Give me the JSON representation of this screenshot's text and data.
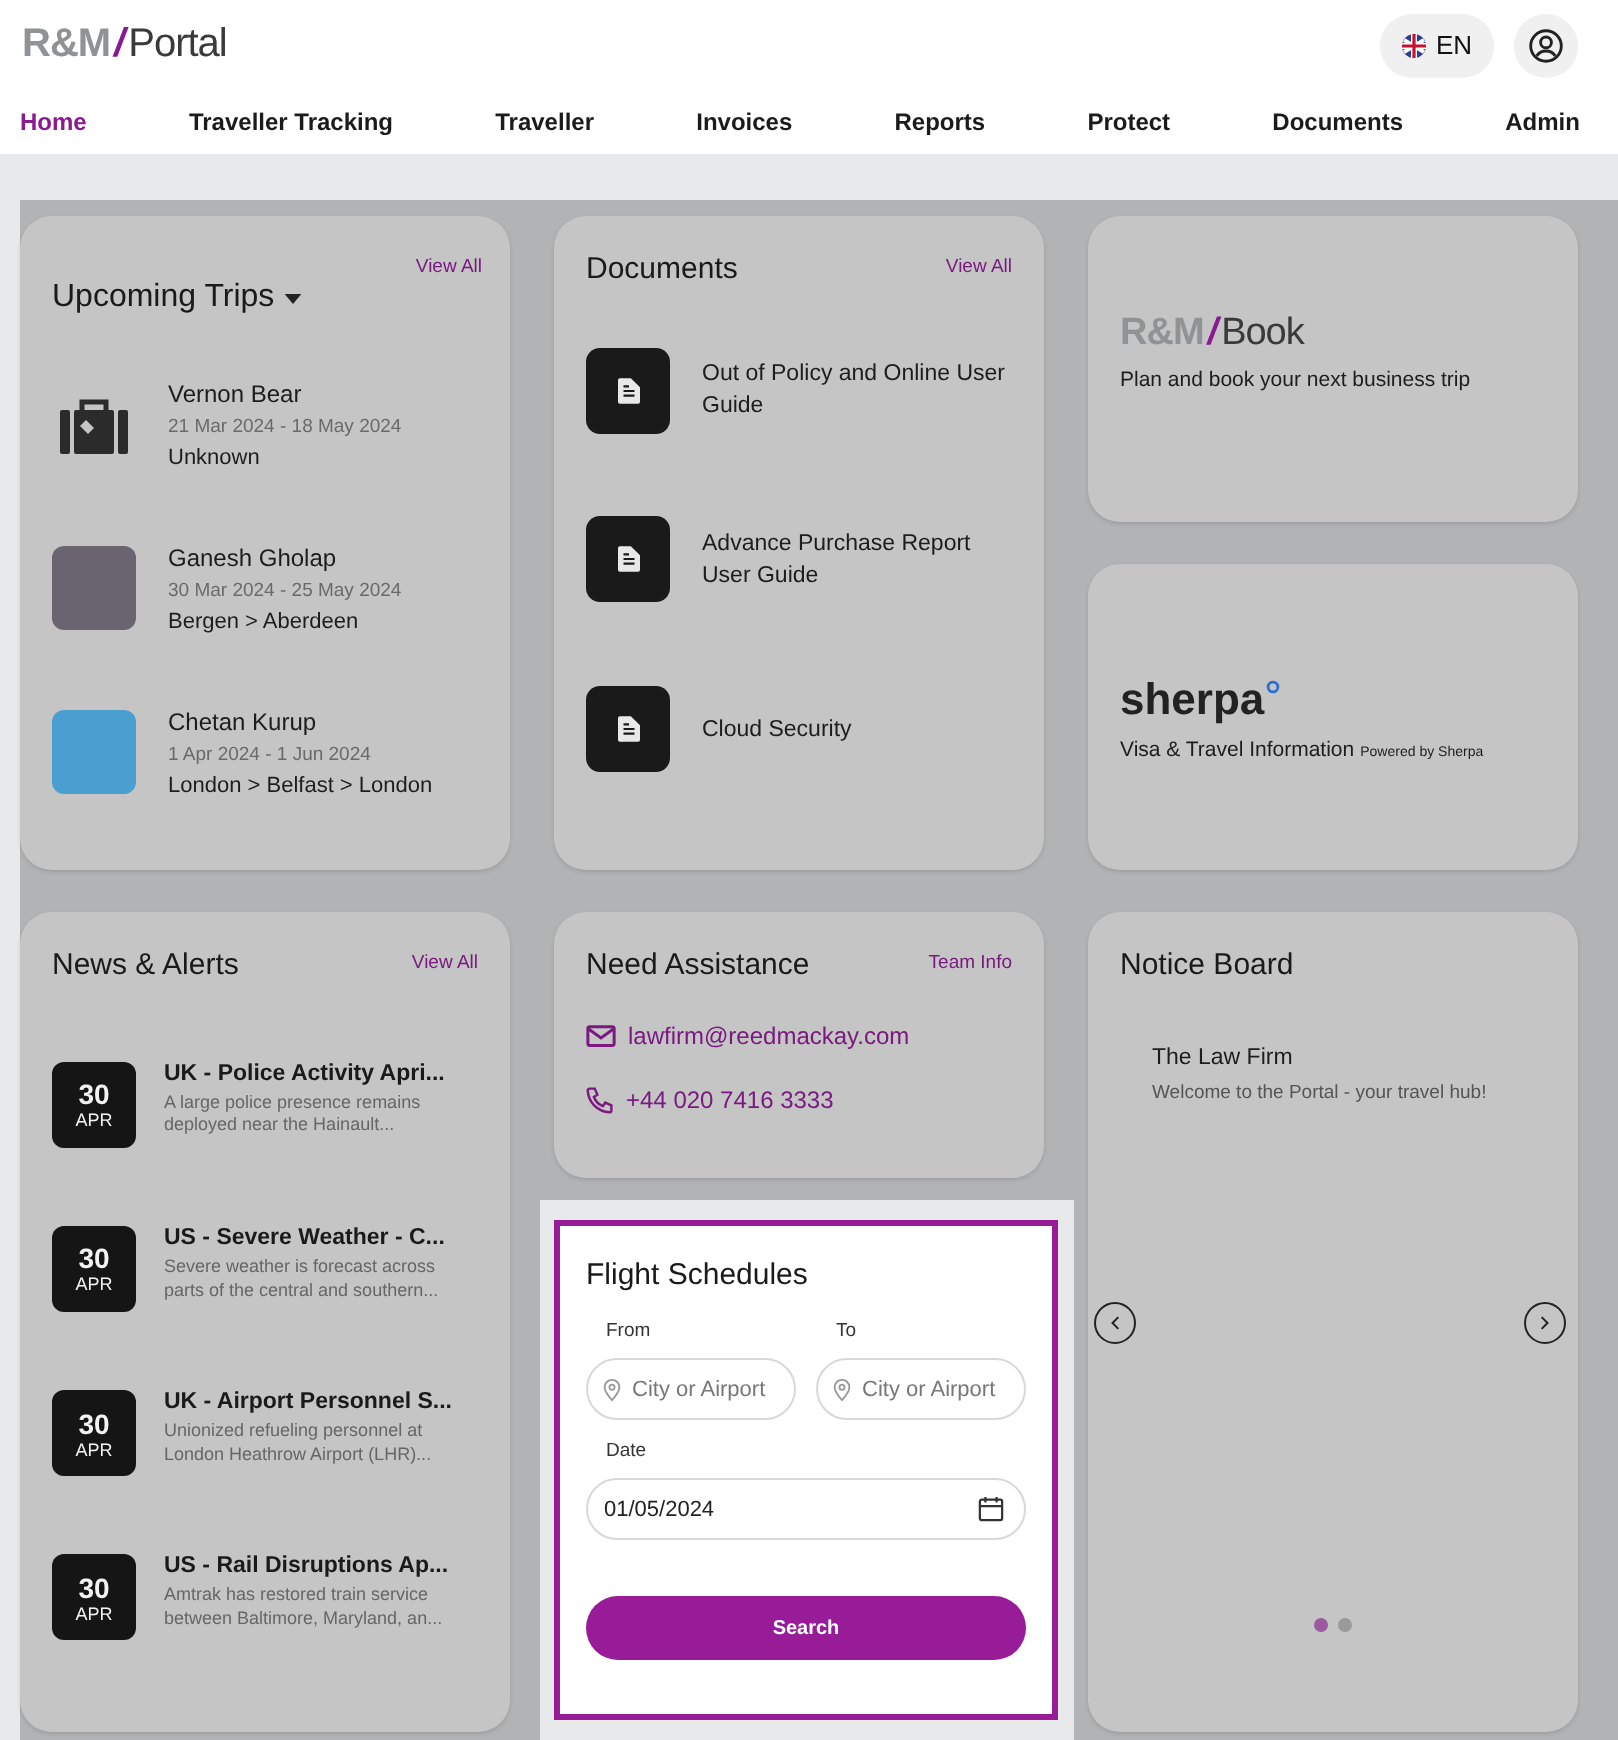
{
  "header": {
    "logo": {
      "mark": "R&M",
      "slash": "/",
      "product": "Portal"
    },
    "language": "EN"
  },
  "nav": [
    {
      "label": "Home",
      "selected": true
    },
    {
      "label": "Traveller Tracking",
      "selected": false
    },
    {
      "label": "Traveller",
      "selected": false
    },
    {
      "label": "Invoices",
      "selected": false
    },
    {
      "label": "Reports",
      "selected": false
    },
    {
      "label": "Protect",
      "selected": false
    },
    {
      "label": "Documents",
      "selected": false
    },
    {
      "label": "Admin",
      "selected": false
    }
  ],
  "upcoming_trips": {
    "title": "Upcoming Trips",
    "link": "View All",
    "items": [
      {
        "kind": "icon",
        "name": "Vernon Bear",
        "dates": "21 Mar 2024 - 18 May 2024",
        "route": "Unknown"
      },
      {
        "kind": "photo",
        "name": "Ganesh Gholap",
        "dates": "30 Mar 2024 - 25 May 2024",
        "route": "Bergen > Aberdeen"
      },
      {
        "kind": "photo",
        "name": "Chetan Kurup",
        "dates": "1 Apr 2024 - 1 Jun 2024",
        "route": "London > Belfast > London"
      }
    ]
  },
  "documents": {
    "title": "Documents",
    "link": "View All",
    "items": [
      "Out of Policy and Online User Guide",
      "Advance Purchase Report User Guide",
      "Cloud Security"
    ]
  },
  "book": {
    "logo": {
      "mark": "R&M",
      "slash": "/",
      "product": "Book"
    },
    "tagline": "Plan and book your next business trip"
  },
  "sherpa": {
    "logo": "sherpa",
    "tagline": "Visa & Travel Information",
    "powered": "Powered by Sherpa"
  },
  "news": {
    "title": "News & Alerts",
    "link": "View All",
    "items": [
      {
        "day": "30",
        "month": "APR",
        "title": "UK - Police Activity Apri...",
        "summary": "A large police presence remains deployed near the Hainault..."
      },
      {
        "day": "30",
        "month": "APR",
        "title": "US - Severe Weather - C...",
        "summary": "Severe weather is forecast across parts of the central and southern..."
      },
      {
        "day": "30",
        "month": "APR",
        "title": "UK - Airport Personnel S...",
        "summary": "Unionized refueling personnel at London Heathrow Airport (LHR)..."
      },
      {
        "day": "30",
        "month": "APR",
        "title": "US - Rail Disruptions Ap...",
        "summary": "Amtrak has restored train service between Baltimore, Maryland, an..."
      }
    ]
  },
  "assistance": {
    "title": "Need Assistance",
    "link": "Team Info",
    "email": "lawfirm@reedmackay.com",
    "phone": "+44 020 7416 3333"
  },
  "flight_schedules": {
    "title": "Flight Schedules",
    "from": {
      "label": "From",
      "placeholder": "City or Airport"
    },
    "to": {
      "label": "To",
      "placeholder": "City or Airport"
    },
    "date": {
      "label": "Date",
      "value": "01/05/2024"
    },
    "button": "Search"
  },
  "notice_board": {
    "title": "Notice Board",
    "heading": "The Law Firm",
    "message": "Welcome to the Portal - your travel hub!",
    "dots": [
      {
        "selected": true
      },
      {
        "selected": false
      }
    ]
  }
}
